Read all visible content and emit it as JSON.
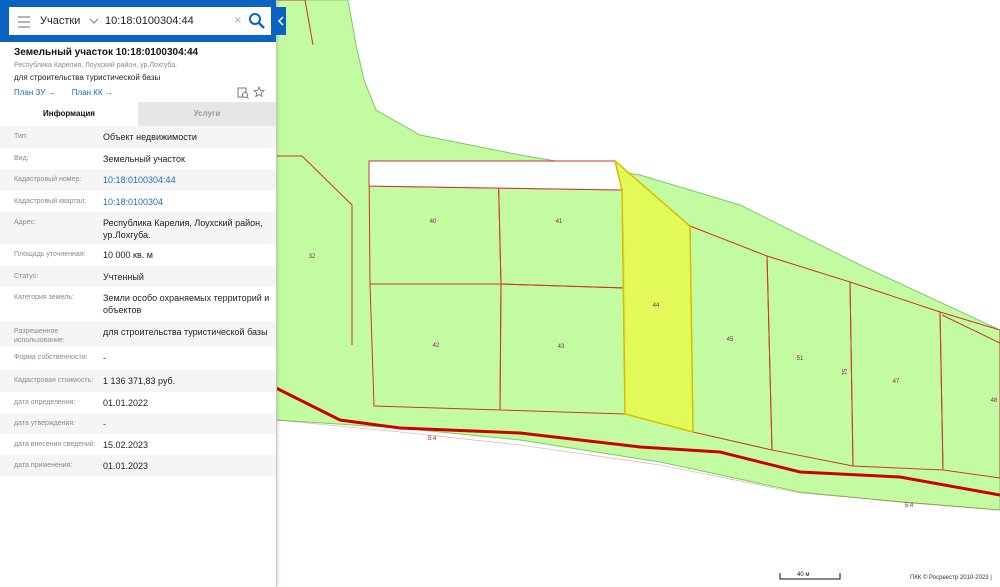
{
  "search": {
    "layer": "Участки",
    "query": "10:18:0100304:44",
    "clear_symbol": "×"
  },
  "feature": {
    "title": "Земельный участок 10:18:0100304:44",
    "address_short": "Республика Карелия, Лоухский район, ур.Лохгуба.",
    "use": "для строительства туристической базы",
    "links": [
      "План ЗУ →",
      "План КК →"
    ]
  },
  "tabs": [
    "Информация",
    "Услуги"
  ],
  "attributes": [
    {
      "key": "Тип:",
      "value": "Объект недвижимости"
    },
    {
      "key": "Вид:",
      "value": "Земельный участок"
    },
    {
      "key": "Кадастровый номер:",
      "value": "10:18:0100304:44"
    },
    {
      "key": "Кадастровый квартал:",
      "value": "10:18:0100304"
    },
    {
      "key": "Адрес:",
      "value": "Республика Карелия, Лоухский район, ур.Лохгуба."
    },
    {
      "key": "Площадь уточненная:",
      "value": "10 000 кв. м"
    },
    {
      "key": "Статус:",
      "value": "Учтенный"
    },
    {
      "key": "Категория земель:",
      "value": "Земли особо охраняемых территорий и объектов"
    },
    {
      "key": "Разрешенное использование:",
      "value": "для строительства туристической базы"
    },
    {
      "key": "Форма собственности:",
      "value": "-"
    },
    {
      "key": "Кадастровая стоимость:",
      "value": "1 136 371,83 руб."
    },
    {
      "key": "дата определения:",
      "value": "01.01.2022"
    },
    {
      "key": "дата утверждения:",
      "value": "-"
    },
    {
      "key": "дата внесения сведений:",
      "value": "15.02.2023"
    },
    {
      "key": "дата применения:",
      "value": "01.01.2023"
    }
  ],
  "map": {
    "parcel_labels": [
      "32",
      "40",
      "41",
      "44",
      "42",
      "43",
      "45",
      "51",
      "47",
      "48"
    ],
    "extra_label": "51",
    "road_labels": [
      "5:4",
      "5:4"
    ],
    "scale": "40 м",
    "attribution": "ПКК © Росреестр 2010-2023 |",
    "colors": {
      "land": "#c3fca0",
      "selected": "#e6fa50",
      "boundary": "#cc3333",
      "road": "#cc0000",
      "dark_ground": "#1e4a20",
      "accent": "#0a62c2"
    }
  }
}
